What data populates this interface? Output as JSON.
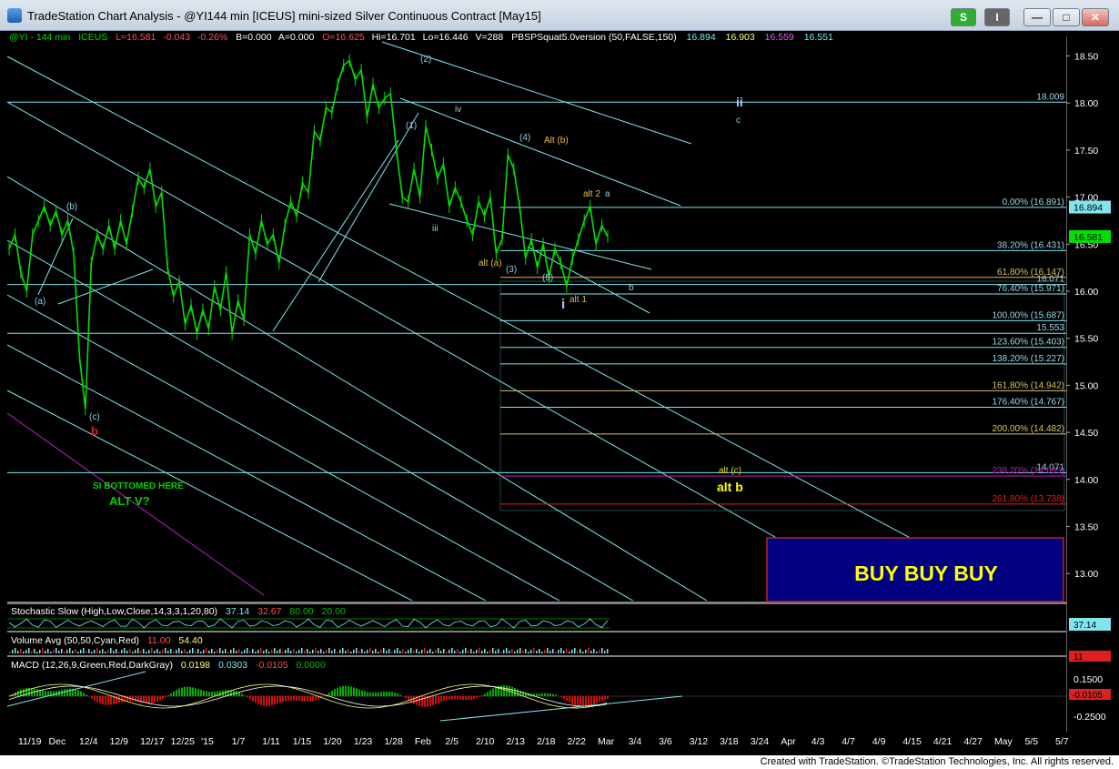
{
  "window": {
    "title": "TradeStation Chart Analysis - @YI144 min [ICEUS] mini-sized Silver Continuous Contract [May15]",
    "btn_s": "S",
    "btn_i": "I"
  },
  "colors": {
    "bg": "#000000",
    "cyan": "#7fe6f0",
    "price": "#00e000",
    "yellow": "#ffff66",
    "gold": "#d8c060",
    "red": "#e02020",
    "magenta": "#c020c0",
    "navy": "#000080"
  },
  "header": {
    "sym": "@YI - 144 min",
    "exch": "ICEUS",
    "last": "L=16.581",
    "chg": "-0.043",
    "pct": "-0.26%",
    "bid": "B=0.000",
    "ask": "A=0.000",
    "open": "O=16.625",
    "hi": "Hi=16.701",
    "lo": "Lo=16.446",
    "vol": "V=288",
    "study": "PBSPSquat5.0version (50,FALSE,150)",
    "v1": "16.894",
    "v2": "16.903",
    "v3": "16.559",
    "v4": "16.551"
  },
  "indicators": {
    "stoch_label": "Stochastic Slow (High,Low,Close,14,3,3,1,20,80)",
    "stoch_v1": "37.14",
    "stoch_v2": "32.67",
    "stoch_v3": "80.00",
    "stoch_v4": "20.00",
    "stoch_axis": "37.14",
    "vol_label": "Volume Avg (50,50,Cyan,Red)",
    "vol_v1": "11.00",
    "vol_v2": "54.40",
    "vol_axis": "11",
    "macd_label": "MACD (12,26,9,Green,Red,DarkGray)",
    "macd_v1": "0.0198",
    "macd_v2": "0.0303",
    "macd_v3": "-0.0105",
    "macd_v4": "0.0000",
    "macd_axis_top": "0.1500",
    "macd_axis_val": "-0.0105",
    "macd_axis_bot": "-0.2500"
  },
  "annotations": {
    "a_small": "(a)",
    "b_small": "(b)",
    "c_small": "(c)",
    "b_red": "b",
    "si_text": "SI BOTTOMED HERE",
    "alt_v": "ALT V?",
    "w1": "(1)",
    "w2": "(2)",
    "w3": "(3)",
    "w4": "(4)",
    "w5": "(5)",
    "iii": "iii",
    "iv": "iv",
    "alt_b_small": "Alt (b)",
    "alt_a": "alt (a)",
    "alt2": "alt 2",
    "a_lower": "a",
    "b_lower": "b",
    "i_big": "i",
    "alt1": "alt 1",
    "ii_big": "ii",
    "c_lower": "c",
    "alt_c": "alt (c)",
    "alt_b_big": "alt b",
    "buy": "BUY BUY BUY"
  },
  "footer_text": "Created with TradeStation. ©TradeStation Technologies, Inc. All rights reserved.",
  "chart_data": {
    "type": "line",
    "ylim": [
      12.75,
      18.65
    ],
    "x_ticks": [
      "11/19",
      "Dec",
      "12/4",
      "12/9",
      "12/17",
      "12/25",
      "'15",
      "1/7",
      "1/11",
      "1/15",
      "1/20",
      "1/23",
      "1/28",
      "Feb",
      "2/5",
      "2/10",
      "2/13",
      "2/18",
      "2/22",
      "Mar",
      "3/4",
      "3/6",
      "3/12",
      "3/18",
      "3/24",
      "Apr",
      "4/3",
      "4/7",
      "4/9",
      "4/15",
      "4/21",
      "4/27",
      "May",
      "5/5",
      "5/7"
    ],
    "y_ticks": [
      13.0,
      13.5,
      14.0,
      14.5,
      15.0,
      15.5,
      16.0,
      16.5,
      17.0,
      17.5,
      18.0,
      18.5
    ],
    "price_path": [
      16.45,
      16.6,
      16.2,
      16.0,
      16.6,
      16.75,
      16.9,
      16.7,
      16.85,
      16.6,
      16.75,
      16.4,
      15.3,
      14.75,
      16.3,
      16.6,
      16.45,
      16.7,
      16.45,
      16.75,
      16.5,
      16.85,
      17.2,
      17.1,
      17.3,
      16.9,
      17.05,
      16.25,
      15.95,
      16.1,
      15.65,
      15.85,
      15.55,
      15.8,
      15.6,
      16.05,
      15.8,
      16.2,
      15.55,
      15.9,
      15.7,
      16.6,
      16.4,
      16.75,
      16.5,
      16.6,
      16.3,
      16.7,
      16.95,
      16.8,
      17.15,
      17.05,
      17.7,
      17.6,
      17.95,
      17.9,
      18.2,
      18.4,
      18.45,
      18.25,
      18.35,
      17.85,
      18.2,
      17.95,
      18.05,
      18.1,
      17.5,
      17.0,
      16.95,
      17.3,
      17.0,
      17.75,
      17.5,
      17.2,
      17.35,
      16.9,
      17.1,
      16.95,
      16.75,
      16.6,
      16.95,
      16.8,
      17.0,
      16.4,
      16.55,
      17.45,
      17.3,
      16.9,
      16.35,
      16.55,
      16.25,
      16.5,
      16.15,
      16.45,
      16.3,
      16.05,
      16.35,
      16.55,
      16.75,
      16.9,
      16.5,
      16.7,
      16.58
    ],
    "levels": [
      {
        "label": "18.009",
        "value": 18.009
      },
      {
        "label": "0.00% (16.891)",
        "value": 16.891
      },
      {
        "label": "38.20% (16.431)",
        "value": 16.431
      },
      {
        "label": "61.80% (16.147)",
        "value": 16.147
      },
      {
        "label": "16.071",
        "value": 16.071
      },
      {
        "label": "76.40% (15.971)",
        "value": 15.971
      },
      {
        "label": "100.00% (15.687)",
        "value": 15.687
      },
      {
        "label": "15.553",
        "value": 15.553
      },
      {
        "label": "123.60% (15.403)",
        "value": 15.403
      },
      {
        "label": "138.20% (15.227)",
        "value": 15.227
      },
      {
        "label": "161.80% (14.942)",
        "value": 14.942
      },
      {
        "label": "176.40% (14.767)",
        "value": 14.767
      },
      {
        "label": "200.00% (14.482)",
        "value": 14.482
      },
      {
        "label": "14.071",
        "value": 14.071
      },
      {
        "label": "238.20% (14.035)",
        "value": 14.035
      },
      {
        "label": "261.80% (13.738)",
        "value": 13.738
      }
    ],
    "last_price": 16.581,
    "top_price_label": 16.894
  }
}
